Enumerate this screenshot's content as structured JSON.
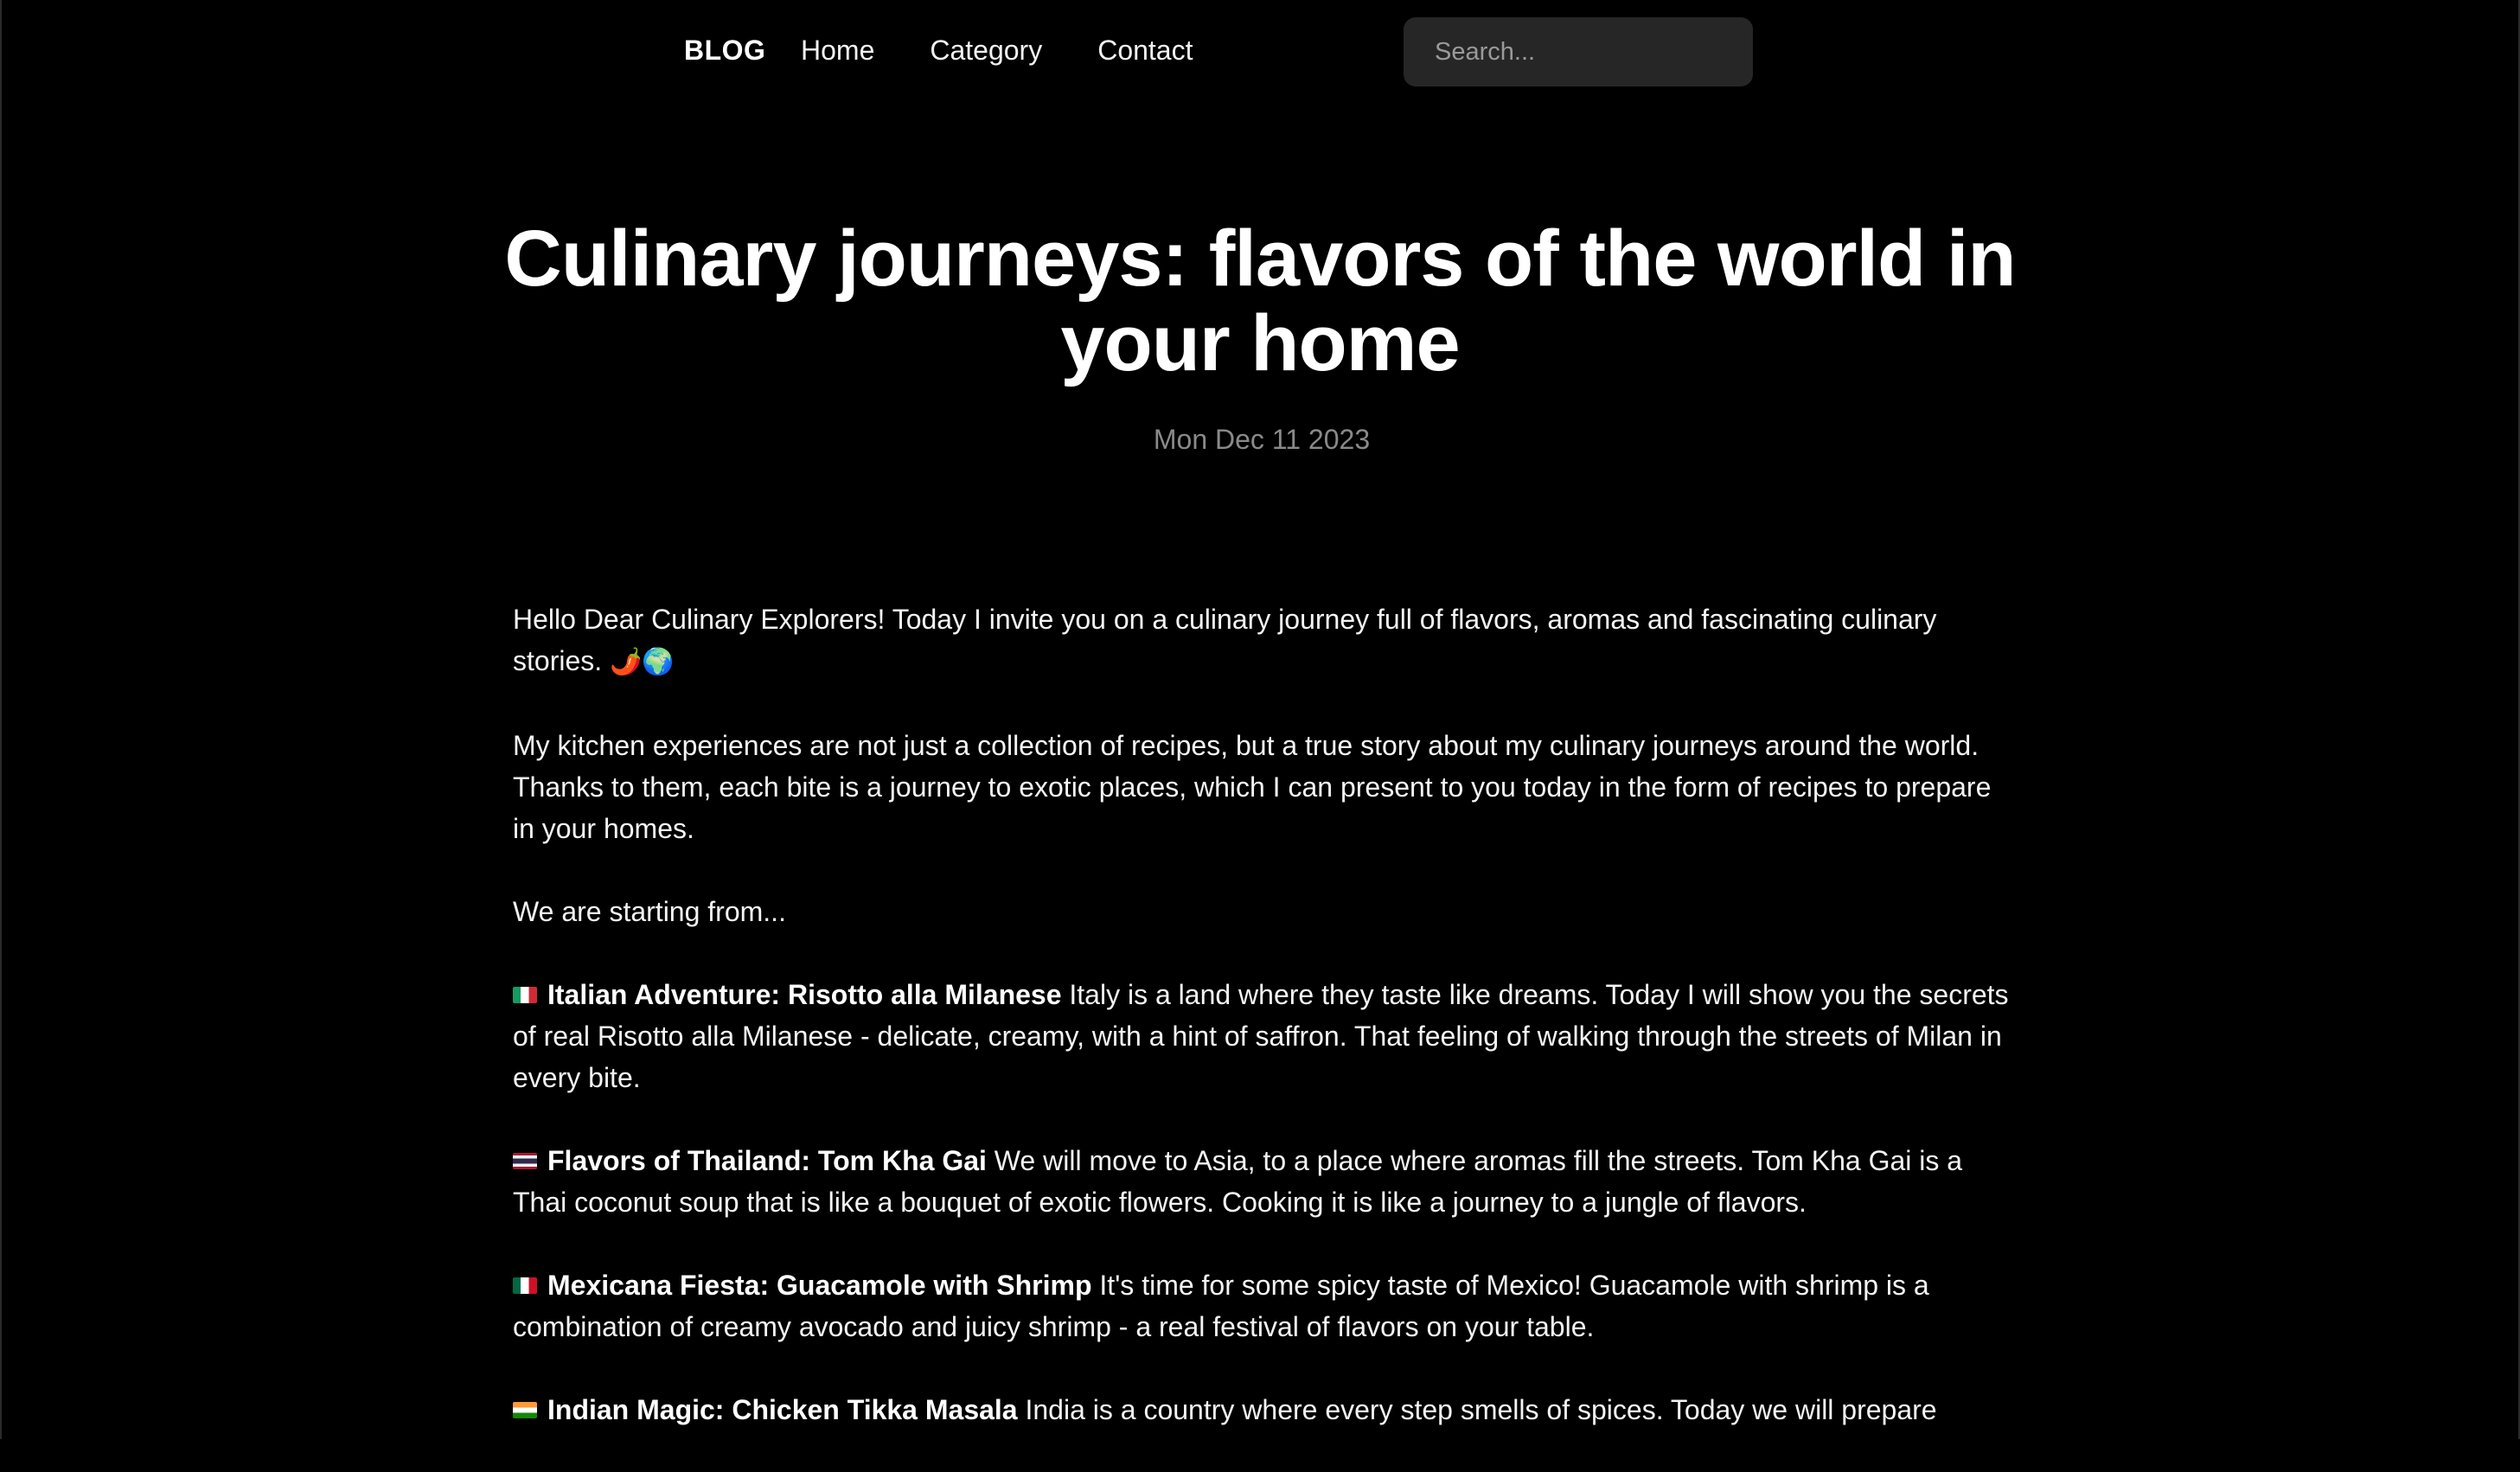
{
  "nav": {
    "brand": "BLOG",
    "links": [
      "Home",
      "Category",
      "Contact"
    ],
    "search_placeholder": "Search..."
  },
  "post": {
    "title": "Culinary journeys: flavors of the world in your home",
    "date": "Mon Dec 11 2023",
    "intro": "Hello Dear Culinary Explorers! Today I invite you on a culinary journey full of flavors, aromas and fascinating culinary stories.",
    "intro_emoji": "🌶️🌍",
    "paragraph2": "My kitchen experiences are not just a collection of recipes, but a true story about my culinary journeys around the world. Thanks to them, each bite is a journey to exotic places, which I can present to you today in the form of recipes to prepare in your homes.",
    "paragraph3": "We are starting from...",
    "sections": [
      {
        "flag": "italy-flag-icon",
        "heading": "Italian Adventure: Risotto alla Milanese",
        "text": "Italy is a land where they taste like dreams. Today I will show you the secrets of real Risotto alla Milanese - delicate, creamy, with a hint of saffron. That feeling of walking through the streets of Milan in every bite."
      },
      {
        "flag": "thailand-flag-icon",
        "heading": "Flavors of Thailand: Tom Kha Gai",
        "text": "We will move to Asia, to a place where aromas fill the streets. Tom Kha Gai is a Thai coconut soup that is like a bouquet of exotic flowers. Cooking it is like a journey to a jungle of flavors."
      },
      {
        "flag": "mexico-flag-icon",
        "heading": "Mexicana Fiesta: Guacamole with Shrimp",
        "text": "It's time for some spicy taste of Mexico! Guacamole with shrimp is a combination of creamy avocado and juicy shrimp - a real festival of flavors on your table."
      },
      {
        "flag": "india-flag-icon",
        "heading": "Indian Magic: Chicken Tikka Masala",
        "text": "India is a country where every step smells of spices. Today we will prepare"
      }
    ]
  },
  "colors": {
    "background": "#000000",
    "text": "#ffffff",
    "muted": "#8a8a8a",
    "search_bg": "#262626"
  }
}
